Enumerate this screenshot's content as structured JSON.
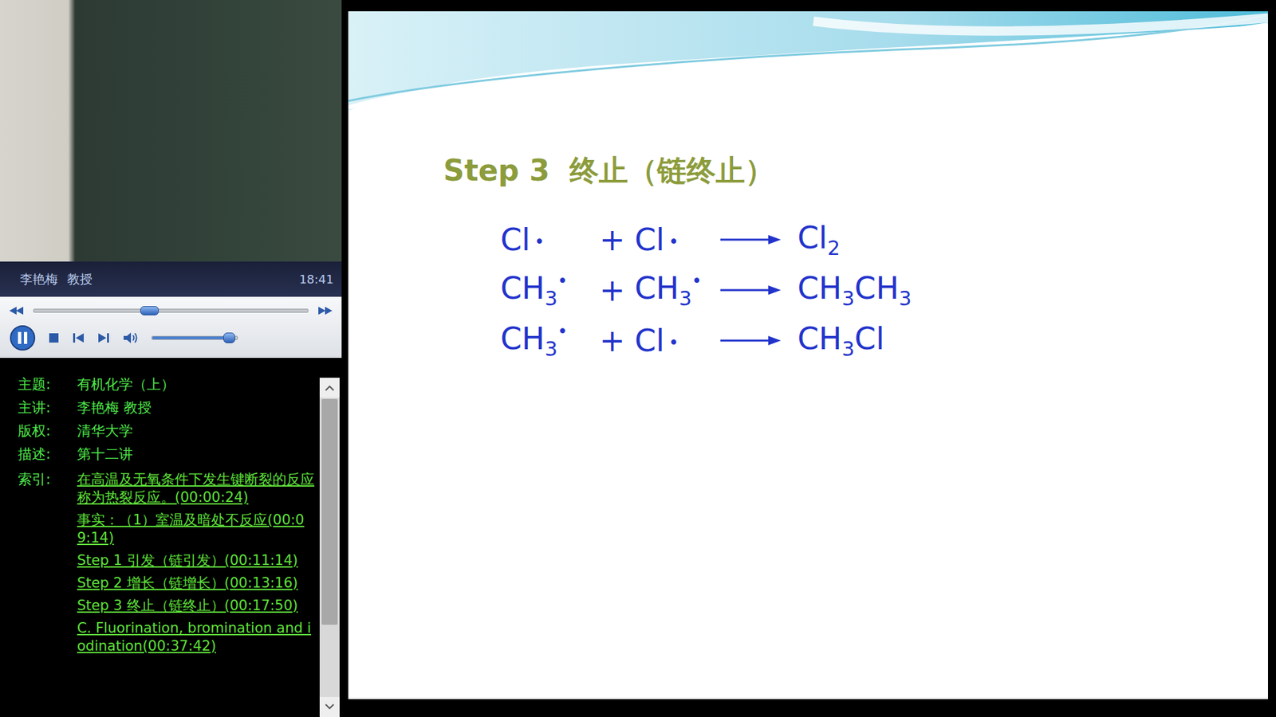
{
  "video": {
    "presenter": "李艳梅",
    "rank": "教授",
    "time": "18:41"
  },
  "player": {
    "playing": true,
    "progress": {
      "level": 0.42
    },
    "volume": {
      "level": 0.9
    }
  },
  "info": {
    "fields": [
      {
        "label": "主题:",
        "value": "有机化学（上）"
      },
      {
        "label": "主讲:",
        "value": "李艳梅 教授"
      },
      {
        "label": "版权:",
        "value": "清华大学"
      },
      {
        "label": "描述:",
        "value": "第十二讲"
      }
    ],
    "index": {
      "label": "索引:",
      "links": [
        "在高温及无氧条件下发生键断裂的反应称为热裂反应。(00:00:24)",
        "事实：（1）室温及暗处不反应(00:09:14)",
        "Step 1 引发（链引发）(00:11:14)",
        "Step 2 增长（链增长）(00:13:16)",
        "Step 3 终止（链终止）(00:17:50)",
        "C. Fluorination, bromination and iodination(00:37:42)"
      ]
    },
    "scroll": {
      "level": 0.76
    }
  },
  "slide": {
    "step": "Step 3",
    "title": "终止（链终止）",
    "equations": [
      {
        "reactants": [
          [
            {
              "text": "Cl",
              "kind": "normal"
            },
            {
              "text": "•",
              "kind": "dot"
            }
          ],
          [
            {
              "text": "Cl",
              "kind": "normal"
            },
            {
              "text": "•",
              "kind": "dot"
            }
          ]
        ],
        "plus": "+",
        "product": [
          {
            "text": "Cl",
            "kind": "normal"
          },
          {
            "text": "2",
            "kind": "sub"
          }
        ]
      },
      {
        "reactants": [
          [
            {
              "text": "CH",
              "kind": "normal"
            },
            {
              "text": "3",
              "kind": "sub"
            },
            {
              "text": "•",
              "kind": "sup"
            }
          ],
          [
            {
              "text": "CH",
              "kind": "normal"
            },
            {
              "text": "3",
              "kind": "sub"
            },
            {
              "text": "•",
              "kind": "sup"
            }
          ]
        ],
        "plus": "+",
        "product": [
          {
            "text": "CH",
            "kind": "normal"
          },
          {
            "text": "3",
            "kind": "sub"
          },
          {
            "text": "CH",
            "kind": "normal"
          },
          {
            "text": "3",
            "kind": "sub"
          }
        ]
      },
      {
        "reactants": [
          [
            {
              "text": "CH",
              "kind": "normal"
            },
            {
              "text": "3",
              "kind": "sub"
            },
            {
              "text": "•",
              "kind": "sup"
            }
          ],
          [
            {
              "text": "Cl",
              "kind": "normal"
            },
            {
              "text": "•",
              "kind": "dot"
            }
          ]
        ],
        "plus": "+",
        "product": [
          {
            "text": "CH",
            "kind": "normal"
          },
          {
            "text": "3",
            "kind": "sub"
          },
          {
            "text": "Cl",
            "kind": "normal"
          }
        ]
      }
    ]
  }
}
